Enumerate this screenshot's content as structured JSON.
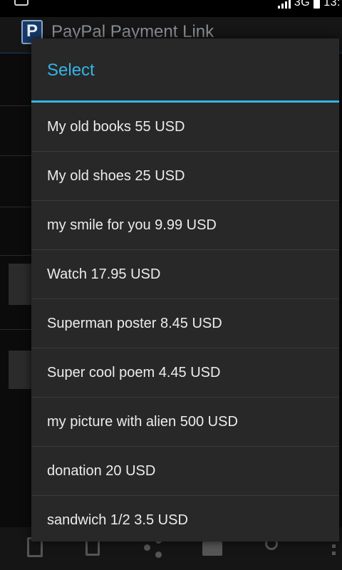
{
  "status_bar": {
    "network": "3G",
    "time_partial": "13:"
  },
  "app_bar": {
    "logo_letter": "P",
    "title": "PayPal Payment Link"
  },
  "dialog": {
    "title": "Select",
    "accent_color": "#33b5e5",
    "items": [
      {
        "label": "My old books 55 USD"
      },
      {
        "label": "My old shoes 25 USD"
      },
      {
        "label": "my smile for you 9.99 USD"
      },
      {
        "label": "Watch 17.95 USD"
      },
      {
        "label": "Superman poster 8.45 USD"
      },
      {
        "label": "Super cool poem 4.45 USD"
      },
      {
        "label": "my picture with alien 500 USD"
      },
      {
        "label": "donation 20 USD"
      },
      {
        "label": "sandwich 1/2 3.5 USD"
      }
    ]
  },
  "bottom_bar": {
    "icons": [
      "document-icon",
      "copy-icon",
      "share-icon",
      "mail-icon",
      "search-icon",
      "overflow-menu-icon"
    ]
  }
}
